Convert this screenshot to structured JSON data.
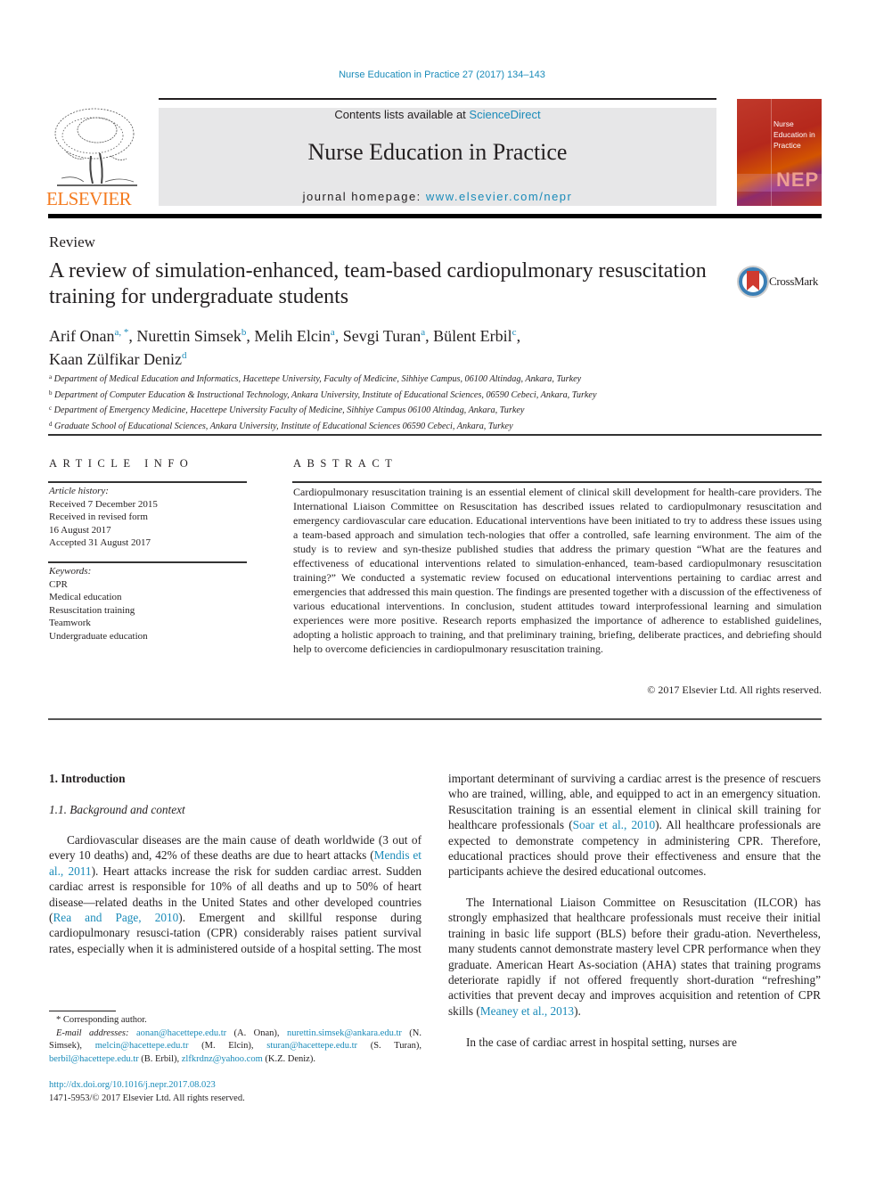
{
  "header": {
    "citation": "Nurse Education in Practice 27 (2017) 134–143",
    "contents_prefix": "Contents lists available at ",
    "contents_link": "ScienceDirect",
    "journal_title": "Nurse Education in Practice",
    "homepage_prefix": "journal homepage: ",
    "homepage_link": "www.elsevier.com/nepr",
    "publisher_logo": "ELSEVIER",
    "cover": {
      "title_line1": "Nurse",
      "title_line2": "Education in",
      "title_line3": "Practice",
      "acronym": "NEP"
    },
    "colors": {
      "link": "#1a8bb9",
      "elsevier_orange": "#f47b20",
      "banner_bg": "#e7e7e8"
    }
  },
  "article": {
    "type": "Review",
    "title": "A review of simulation-enhanced, team-based cardiopulmonary resuscitation training for undergraduate students",
    "crossmark_label": "CrossMark",
    "authors": [
      {
        "name": "Arif Onan",
        "affil": "a, *"
      },
      {
        "name": "Nurettin Simsek",
        "affil": "b"
      },
      {
        "name": "Melih Elcin",
        "affil": "a"
      },
      {
        "name": "Sevgi Turan",
        "affil": "a"
      },
      {
        "name": "Bülent Erbil",
        "affil": "c"
      },
      {
        "name": "Kaan Zülfikar Deniz",
        "affil": "d"
      }
    ],
    "affiliations": [
      {
        "key": "a",
        "text": "Department of Medical Education and Informatics, Hacettepe University, Faculty of Medicine, Sihhiye Campus, 06100 Altindag, Ankara, Turkey"
      },
      {
        "key": "b",
        "text": "Department of Computer Education & Instructional Technology, Ankara University, Institute of Educational Sciences, 06590 Cebeci, Ankara, Turkey"
      },
      {
        "key": "c",
        "text": "Department of Emergency Medicine, Hacettepe University Faculty of Medicine, Sihhiye Campus 06100 Altindag, Ankara, Turkey"
      },
      {
        "key": "d",
        "text": "Graduate School of Educational Sciences, Ankara University, Institute of Educational Sciences 06590 Cebeci, Ankara, Turkey"
      }
    ]
  },
  "article_info": {
    "heading": "ARTICLE INFO",
    "history_label": "Article history:",
    "history": [
      "Received 7 December 2015",
      "Received in revised form",
      "16 August 2017",
      "Accepted 31 August 2017"
    ],
    "keywords_label": "Keywords:",
    "keywords": [
      "CPR",
      "Medical education",
      "Resuscitation training",
      "Teamwork",
      "Undergraduate education"
    ]
  },
  "abstract": {
    "heading": "ABSTRACT",
    "text": "Cardiopulmonary resuscitation training is an essential element of clinical skill development for health-care providers. The International Liaison Committee on Resuscitation has described issues related to cardiopulmonary resuscitation and emergency cardiovascular care education. Educational interventions have been initiated to try to address these issues using a team-based approach and simulation tech-nologies that offer a controlled, safe learning environment. The aim of the study is to review and syn-thesize published studies that address the primary question “What are the features and effectiveness of educational interventions related to simulation-enhanced, team-based cardiopulmonary resuscitation training?” We conducted a systematic review focused on educational interventions pertaining to cardiac arrest and emergencies that addressed this main question. The findings are presented together with a discussion of the effectiveness of various educational interventions. In conclusion, student attitudes toward interprofessional learning and simulation experiences were more positive. Research reports emphasized the importance of adherence to established guidelines, adopting a holistic approach to training, and that preliminary training, briefing, deliberate practices, and debriefing should help to overcome deficiencies in cardiopulmonary resuscitation training.",
    "copyright": "© 2017 Elsevier Ltd. All rights reserved."
  },
  "body": {
    "section1_heading": "1.  Introduction",
    "subsection_heading": "1.1.  Background and context",
    "p1": {
      "t1": "Cardiovascular diseases are the main cause of death worldwide (3 out of every 10 deaths) and, 42% of these deaths are due to heart attacks (",
      "ref1": "Mendis et al., 2011",
      "t2": "). Heart attacks increase the risk for sudden cardiac arrest. Sudden cardiac arrest is responsible for 10% of all deaths and up to 50% of heart disease—related deaths in the United States and other developed countries (",
      "ref2": "Rea and Page, 2010",
      "t3": "). Emergent and skillful response during cardiopulmonary resusci-tation (CPR) considerably raises patient survival rates, especially when it is administered outside of a hospital setting. The most"
    },
    "p2": {
      "t1": "important determinant of surviving a cardiac arrest is the presence of rescuers who are trained, willing, able, and equipped to act in an emergency situation. Resuscitation training is an essential element in clinical skill training for healthcare professionals (",
      "ref1": "Soar et al., 2010",
      "t2": "). All healthcare professionals are expected to demonstrate competency in administering CPR. Therefore, educational practices should prove their effectiveness and ensure that the participants achieve the desired educational outcomes."
    },
    "p3": {
      "t1": "The International Liaison Committee on Resuscitation (ILCOR) has strongly emphasized that healthcare professionals must receive their initial training in basic life support (BLS) before their gradu-ation. Nevertheless, many students cannot demonstrate mastery level CPR performance when they graduate. American Heart As-sociation (AHA) states that training programs deteriorate rapidly if not offered frequently short-duration “refreshing” activities that prevent decay and improves acquisition and retention of CPR skills (",
      "ref1": "Meaney et al., 2013",
      "t2": ")."
    },
    "p4": "In the case of cardiac arrest in hospital setting, nurses are"
  },
  "footnotes": {
    "corresponding": "* Corresponding author.",
    "email_label": "E-mail addresses:",
    "emails": [
      {
        "email": "aonan@hacettepe.edu.tr",
        "who": " (A. Onan), "
      },
      {
        "email": "nurettin.simsek@ankara.edu.tr",
        "who": " (N. Simsek), "
      },
      {
        "email": "melcin@hacettepe.edu.tr",
        "who": " (M. Elcin), "
      },
      {
        "email": "sturan@hacettepe.edu.tr",
        "who": " (S. Turan), "
      },
      {
        "email": "berbil@hacettepe.edu.tr",
        "who": " (B. Erbil), "
      },
      {
        "email": "zlfkrdnz@yahoo.com",
        "who": " (K.Z. Deniz)."
      }
    ],
    "doi": "http://dx.doi.org/10.1016/j.nepr.2017.08.023",
    "issn_line": "1471-5953/© 2017 Elsevier Ltd. All rights reserved."
  }
}
